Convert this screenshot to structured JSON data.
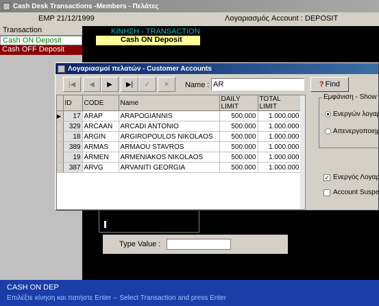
{
  "window": {
    "title": "Cash Desk Transactions  -Members - Πελάτες"
  },
  "infobar": {
    "emp": "EMP  21/12/1999",
    "account": "Λογαριασμός Account :  DEPOSIT"
  },
  "left_panel": {
    "header": "Transaction",
    "items": [
      "Cash ON Deposit",
      "Cash OFF Deposit"
    ]
  },
  "main": {
    "kinisi": "ΚΙΝΗΣΗ - TRANSACTION",
    "selected": "Cash ON Deposit"
  },
  "dialog": {
    "title": "Λογαριασμοί πελατών - Customer Accounts",
    "name_label": "Name :",
    "name_value": "AR",
    "find_label": "Find",
    "columns": [
      "ID",
      "CODE",
      "Name",
      "DAILY LIMIT",
      "TOTAL LIMIT"
    ],
    "rows": [
      [
        "17",
        "ARAP",
        "ARAPOGIANNIS",
        "500.000",
        "1.000.000"
      ],
      [
        "329",
        "ARCAAN",
        "ARCADI ANTONIO",
        "500.000",
        "1.000.000"
      ],
      [
        "18",
        "ARGIN",
        "ARGIROPOULOS NIKOLAOS",
        "500.000",
        "1.000.000"
      ],
      [
        "389",
        "ARMAS",
        "ARMAOU STAVROS",
        "500.000",
        "1.000.000"
      ],
      [
        "19",
        "ARMEN",
        "ARMENIAKOS NIKOLAOS",
        "500.000",
        "1.000.000"
      ],
      [
        "387",
        "ARVG",
        "ARVANITI GEORGIA",
        "500.000",
        "1.000.000"
      ]
    ],
    "show_group": {
      "legend": "Εμφάνιση - Show",
      "options": [
        "Ενεργών λογαρ",
        "Απενεργοποιημ"
      ]
    },
    "check1": "Ενεργός Λογαρι",
    "check2": "Account Suspen"
  },
  "type_value_label": "Type Value :",
  "status": {
    "line1": "CASH ON DEP",
    "line2": "Επιλέξτε κίνηση και πατήστε Enter -- Select Transaction and press Enter"
  }
}
